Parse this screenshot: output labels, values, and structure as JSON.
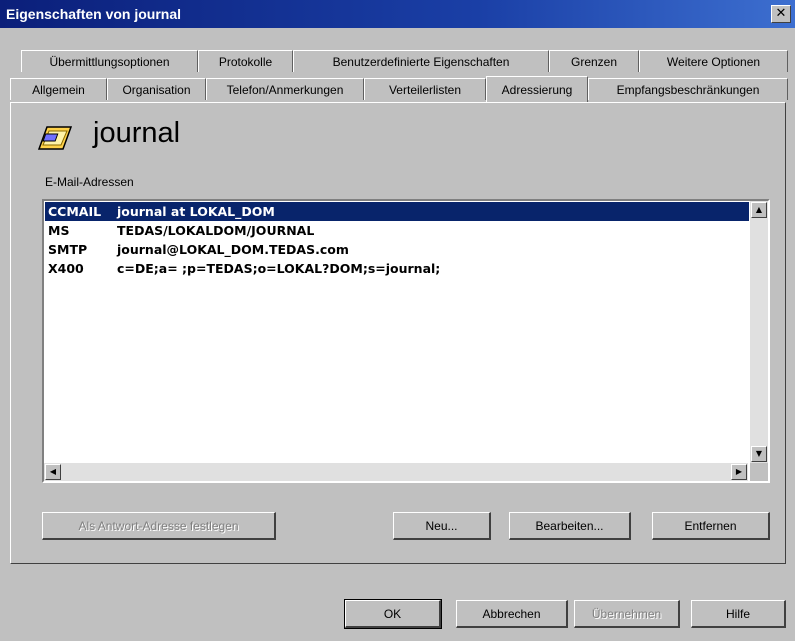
{
  "window": {
    "title": "Eigenschaften von journal"
  },
  "tabs_row1": [
    "Übermittlungsoptionen",
    "Protokolle",
    "Benutzerdefinierte Eigenschaften",
    "Grenzen",
    "Weitere Optionen"
  ],
  "tabs_row2": [
    "Allgemein",
    "Organisation",
    "Telefon/Anmerkungen",
    "Verteilerlisten",
    "Adressierung",
    "Empfangsbeschränkungen"
  ],
  "active_tab": "Adressierung",
  "header": {
    "name": "journal",
    "icon": "mailbox-icon"
  },
  "addresses": {
    "label": "E-Mail-Adressen",
    "rows": [
      {
        "type": "CCMAIL",
        "value": "journal at LOKAL_DOM",
        "selected": true
      },
      {
        "type": "MS",
        "value": "TEDAS/LOKALDOM/JOURNAL",
        "selected": false
      },
      {
        "type": "SMTP",
        "value": "journal@LOKAL_DOM.TEDAS.com",
        "selected": false
      },
      {
        "type": "X400",
        "value": "c=DE;a= ;p=TEDAS;o=LOKAL?DOM;s=journal;",
        "selected": false
      }
    ]
  },
  "buttons": {
    "set_reply": "Als Antwort-Adresse festlegen",
    "new": "Neu...",
    "edit": "Bearbeiten...",
    "remove": "Entfernen"
  },
  "footer": {
    "ok": "OK",
    "cancel": "Abbrechen",
    "apply": "Übernehmen",
    "help": "Hilfe"
  },
  "colors": {
    "title_bar": "#0b1f7a",
    "selection": "#08246b",
    "face": "#c0c0c0"
  }
}
